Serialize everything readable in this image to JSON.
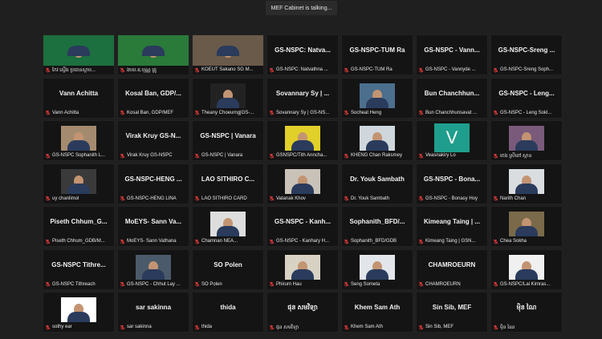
{
  "speaker_label": "MEF Cabinet is talking...",
  "tiles": [
    {
      "center": "",
      "label": "កែវ ស្ដើង ប្រធានស្ដាប...",
      "kind": "video",
      "bg": "#1c6f3e"
    },
    {
      "center": "",
      "label": "ងាយ.ឌ.បុណ្ណ គ្រូ",
      "kind": "video",
      "bg": "#2a7a3a"
    },
    {
      "center": "",
      "label": "KOEUT Sakano SG M...",
      "kind": "video",
      "bg": "#6a5a4a"
    },
    {
      "center": "GS-NSPC: Natva...",
      "label": "GS-NSPC: Natvathna ...",
      "kind": "name"
    },
    {
      "center": "GS-NSPC-TUM Ra",
      "label": "GS-NSPC-TUM Ra",
      "kind": "name"
    },
    {
      "center": "GS-NSPC - Vann...",
      "label": "GS-NSPC - Vannyde ...",
      "kind": "name"
    },
    {
      "center": "GS-NSPC-Sreng ...",
      "label": "GS-NSPC-Sreng Soph...",
      "kind": "name"
    },
    {
      "center": "Vann Achitta",
      "label": "Vann Achitta",
      "kind": "name"
    },
    {
      "center": "Kosal Ban, GDP/...",
      "label": "Kosal Ban, GDP/MEF",
      "kind": "name"
    },
    {
      "center": "",
      "label": "Theany Choeurng|GS-...",
      "kind": "photo",
      "bg": "#222"
    },
    {
      "center": "Sovannary Sy | ...",
      "label": "Sovannary Sy | GS-NS...",
      "kind": "name"
    },
    {
      "center": "",
      "label": "Socheat Heng",
      "kind": "photo",
      "bg": "#4c6f8e"
    },
    {
      "center": "Bun Chanchhun...",
      "label": "Bun Chanchhunsavat ...",
      "kind": "name"
    },
    {
      "center": "GS-NSPC - Leng...",
      "label": "GS-NSPC - Leng Sokl...",
      "kind": "name"
    },
    {
      "center": "",
      "label": "GS-NSPC Sophanith L...",
      "kind": "photo",
      "bg": "#a48b6f"
    },
    {
      "center": "Virak Kruy GS-N...",
      "label": "Virak Kruy GS-NSPC",
      "kind": "name"
    },
    {
      "center": "GS-NSPC | Vanara",
      "label": "GS-NSPC | Vanara",
      "kind": "name"
    },
    {
      "center": "",
      "label": "GSNSPC/Tith Anncha...",
      "kind": "photo",
      "bg": "#e1cf2a"
    },
    {
      "center": "",
      "label": "KHENG Chan Raksmey",
      "kind": "photo",
      "bg": "#cfd7dd"
    },
    {
      "center": "",
      "label": "Veasnakiry Lo",
      "kind": "avatar",
      "avatar": "V"
    },
    {
      "center": "",
      "label": "ចេង ស្រីពៅ ស្កាន",
      "kind": "photo",
      "bg": "#7a5a7a"
    },
    {
      "center": "",
      "label": "uy chanlimol",
      "kind": "photo",
      "bg": "#3a3a3a"
    },
    {
      "center": "GS-NSPC-HENG ...",
      "label": "GS-NSPC-HENG LINA",
      "kind": "name"
    },
    {
      "center": "LAO SITHIRO C...",
      "label": "LAO SITHIRO CARD",
      "kind": "name"
    },
    {
      "center": "",
      "label": "Vatanak Khov",
      "kind": "photo",
      "bg": "#c9c2b8"
    },
    {
      "center": "Dr. Youk Sambath",
      "label": "Dr. Youk Sambath",
      "kind": "name"
    },
    {
      "center": "GS-NSPC - Bona...",
      "label": "GS-NSPC - Bonasy Hoy",
      "kind": "name"
    },
    {
      "center": "",
      "label": "Narith Chan",
      "kind": "photo",
      "bg": "#d9dde0"
    },
    {
      "center": "Piseth Chhum_G...",
      "label": "Piseth Chhum_GDB/M...",
      "kind": "name"
    },
    {
      "center": "MoEYS- Sann Va...",
      "label": "MoEYS- Sann Vathana",
      "kind": "name"
    },
    {
      "center": "",
      "label": "Chamnan NEA...",
      "kind": "photo",
      "bg": "#ddd"
    },
    {
      "center": "GS-NSPC - Kanh...",
      "label": "GS-NSPC - Kanhary H...",
      "kind": "name"
    },
    {
      "center": "Sophanith_BFD/...",
      "label": "Sophanith_BFD/GDB",
      "kind": "name"
    },
    {
      "center": "Kimeang Taing | ...",
      "label": "Kimeang Taing | GSN...",
      "kind": "name"
    },
    {
      "center": "",
      "label": "Chea Sokha",
      "kind": "photo",
      "bg": "#7a6a4a"
    },
    {
      "center": "GS-NSPC Tithre...",
      "label": "GS-NSPC Tithreach",
      "kind": "name"
    },
    {
      "center": "",
      "label": "GS-NSPC - Chhut Lay ...",
      "kind": "photo",
      "bg": "#4a5a6a"
    },
    {
      "center": "SO Polen",
      "label": "SO Polen",
      "kind": "name"
    },
    {
      "center": "",
      "label": "Phirum Hau",
      "kind": "photo",
      "bg": "#d8d2c4"
    },
    {
      "center": "",
      "label": "Seng Someta",
      "kind": "photo",
      "bg": "#e2e6ea"
    },
    {
      "center": "CHAMROEURN",
      "label": "CHAMROEURN",
      "kind": "name"
    },
    {
      "center": "",
      "label": "GS-NSPC/Lai Kimras...",
      "kind": "photo",
      "bg": "#f0f0f0"
    },
    {
      "center": "",
      "label": "sothy ear",
      "kind": "photo",
      "bg": "#ffffff"
    },
    {
      "center": "sar sakinna",
      "label": "sar sakinna",
      "kind": "name"
    },
    {
      "center": "thida",
      "label": "thida",
      "kind": "name"
    },
    {
      "center": "ផុន សមវិទ្យា",
      "label": "ផុន សមវិទ្យា",
      "kind": "name"
    },
    {
      "center": "Khem Sam Ath",
      "label": "Khem Sam Ath",
      "kind": "name"
    },
    {
      "center": "Sin Sib, MEF",
      "label": "Sin Sib, MEF",
      "kind": "name"
    },
    {
      "center": "ម៉ិន ណៃ",
      "label": "ម៉ិន ណៃ",
      "kind": "name"
    }
  ],
  "colors": {
    "background": "#1f1f1f",
    "tile": "#141414",
    "mic_muted": "#e03a3a"
  }
}
